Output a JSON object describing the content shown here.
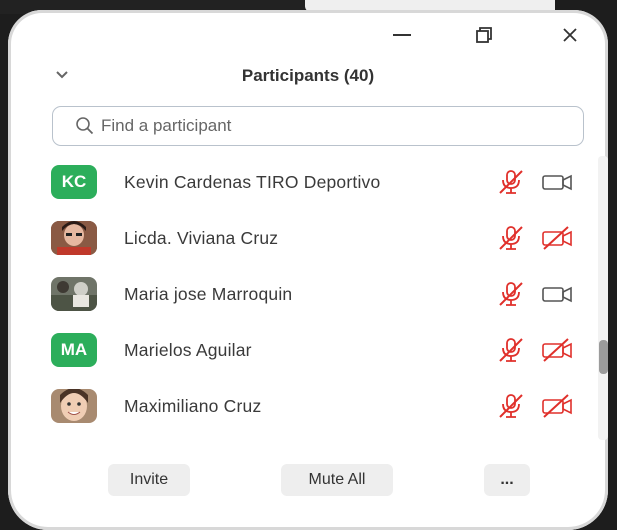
{
  "panel": {
    "title": "Participants (40)",
    "search": {
      "placeholder": "Find a participant",
      "value": ""
    }
  },
  "participants": [
    {
      "name": "Kevin Cardenas  TIRO Deportivo",
      "avatar": "KC",
      "avatar_type": "initials",
      "mic": "muted",
      "video": "on"
    },
    {
      "name": "Licda. Viviana Cruz",
      "avatar": "photo",
      "avatar_type": "photo",
      "mic": "muted",
      "video": "off"
    },
    {
      "name": "Maria jose Marroquin",
      "avatar": "photo",
      "avatar_type": "photo",
      "mic": "muted",
      "video": "on"
    },
    {
      "name": "Marielos Aguilar",
      "avatar": "MA",
      "avatar_type": "initials",
      "mic": "muted",
      "video": "off"
    },
    {
      "name": "Maximiliano Cruz",
      "avatar": "photo",
      "avatar_type": "photo",
      "mic": "muted",
      "video": "off"
    }
  ],
  "footer": {
    "invite_label": "Invite",
    "mute_all_label": "Mute All",
    "more_label": "..."
  },
  "colors": {
    "initials_avatar": "#2cae5b",
    "muted_red": "#e0302b",
    "icon_gray": "#555555"
  },
  "icons": {
    "collapse": "chevron-down-icon",
    "search": "search-icon",
    "minimize": "minimize-icon",
    "restore": "restore-icon",
    "close": "close-icon",
    "mic_muted": "mic-muted-icon",
    "video_on": "video-camera-icon",
    "video_off": "video-off-icon"
  }
}
